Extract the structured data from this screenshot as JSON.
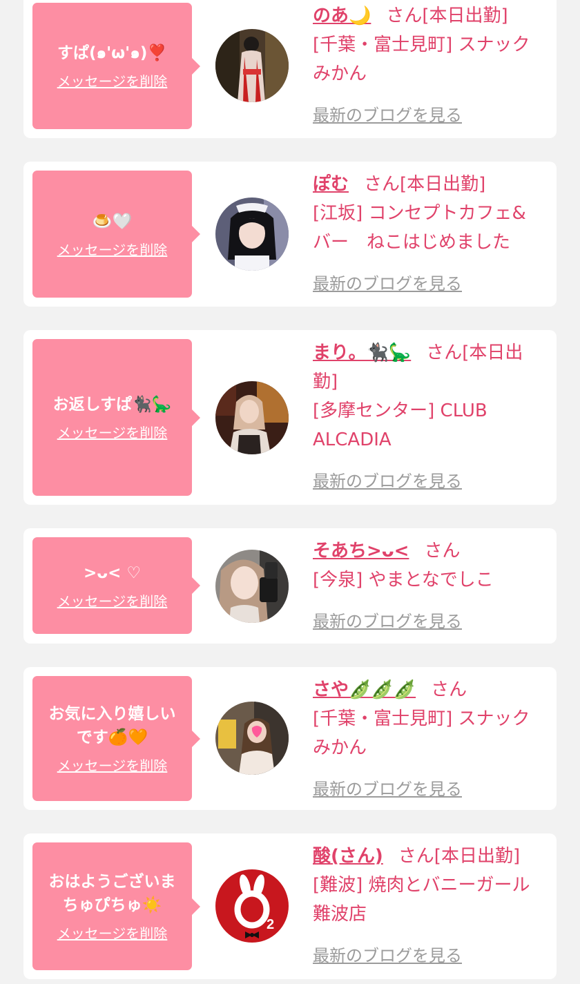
{
  "cards": [
    {
      "message": "すぱ(๑'ω'๑)❣️",
      "delete_label": "メッセージを削除",
      "name": "のあ🌙",
      "honorific": "さん",
      "status": "[本日出勤]",
      "shop_line1": "[千葉・富士見町] スナック",
      "shop_line2": "みかん",
      "blog_label": "最新のブログを見る",
      "avatar_icon": "avatar-photo-kimono"
    },
    {
      "message": "🍮🤍",
      "delete_label": "メッセージを削除",
      "name": "ぽむ",
      "honorific": "さん",
      "status": "[本日出勤]",
      "shop_line1": "[江坂] コンセプトカフェ&",
      "shop_line2": "バー　ねこはじめました",
      "blog_label": "最新のブログを見る",
      "avatar_icon": "avatar-photo-maid"
    },
    {
      "message": "お返しすぱ🐈‍⬛🦕",
      "delete_label": "メッセージを削除",
      "name": "まり。🐈‍⬛🦕",
      "honorific": "さん",
      "status_line1": "[本日出",
      "status_line2": "勤]",
      "shop_line1": "[多摩センター] CLUB",
      "shop_line2": "ALCADIA",
      "blog_label": "最新のブログを見る",
      "avatar_icon": "avatar-photo-woman"
    },
    {
      "message": ">ᴗ< ♡",
      "delete_label": "メッセージを削除",
      "name": "そあち>ᴗ<",
      "honorific": "さん",
      "shop_line1": "[今泉] やまとなでしこ",
      "blog_label": "最新のブログを見る",
      "avatar_icon": "avatar-photo-selfie"
    },
    {
      "message": "お気に入り嬉しい\nです🍊🧡",
      "delete_label": "メッセージを削除",
      "name": "さや🫛🫛🫛",
      "honorific": "さん",
      "shop_line1": "[千葉・富士見町] スナック",
      "shop_line2": "みかん",
      "blog_label": "最新のブログを見る",
      "avatar_icon": "avatar-photo-mirror"
    },
    {
      "message": "おはようございま\nちゅぴちゅ☀️",
      "delete_label": "メッセージを削除",
      "name": "酸(さん)",
      "honorific": "さん",
      "status": "[本日出勤]",
      "shop_line1": "[難波] 焼肉とバニーガール",
      "shop_line2": "難波店",
      "blog_label": "最新のブログを見る",
      "avatar_icon": "bunny-o2-logo-icon"
    }
  ]
}
